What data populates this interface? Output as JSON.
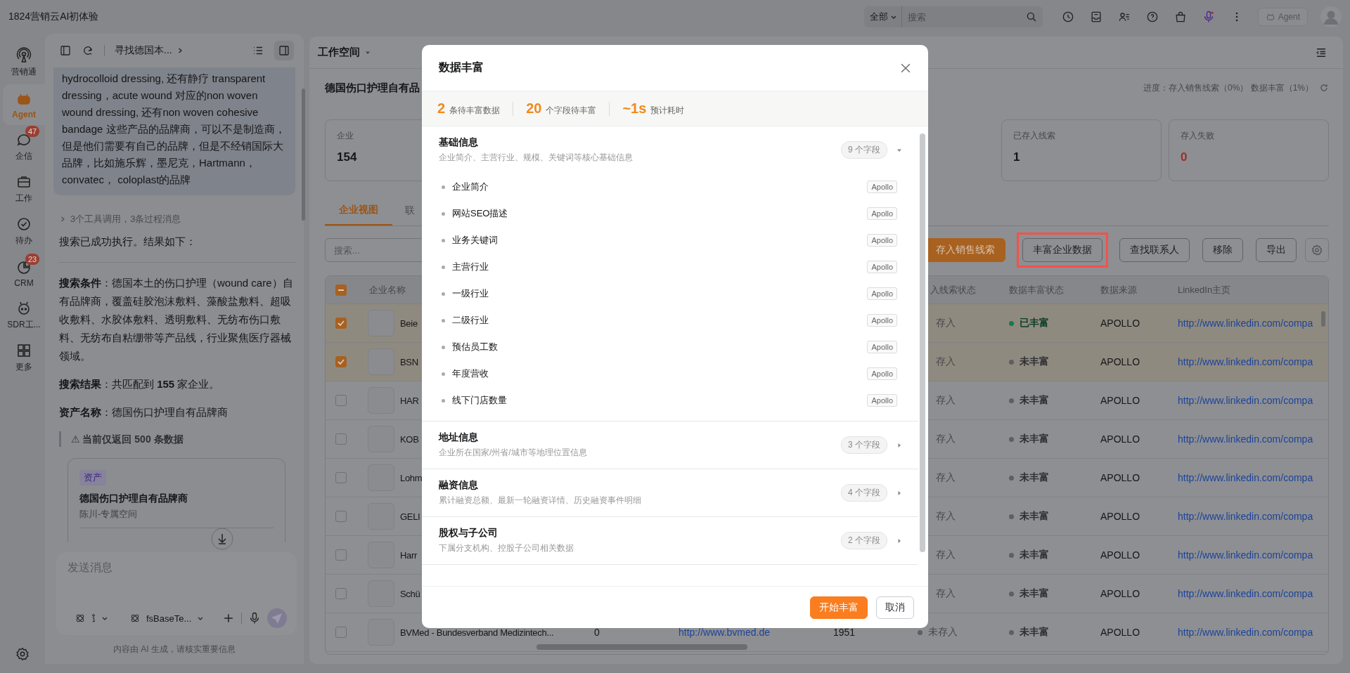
{
  "app_title": "1824营销云AI初体验",
  "top_search": {
    "scope": "全部",
    "placeholder": "搜索"
  },
  "agent_button": {
    "label": "Agent",
    "disabled": true
  },
  "nav_rail": [
    {
      "label": "营销通",
      "selected": false
    },
    {
      "label": "Agent",
      "selected": true
    },
    {
      "label": "企信",
      "selected": false,
      "badge": "47"
    },
    {
      "label": "工作",
      "selected": false
    },
    {
      "label": "待办",
      "selected": false
    },
    {
      "label": "CRM",
      "selected": false,
      "badge": "23"
    },
    {
      "label": "SDR工...",
      "selected": false
    },
    {
      "label": "更多",
      "selected": false
    }
  ],
  "chat": {
    "title": "寻找德国本...",
    "user_message": "hydrocolloid dressing, 还有静疗 transparent dressing，acute wound 对应的non woven wound dressing, 还有non woven cohesive bandage 这些产品的品牌商，可以不是制造商，但是他们需要有自己的品牌，但是不经销国际大品牌，比如施乐辉，墨尼克，Hartmann，convatec， coloplast的品牌",
    "tool_summary": "3个工具调用，3条过程消息",
    "result_intro": "搜索已成功执行。结果如下：",
    "paragraphs": [
      "**搜索条件**：德国本土的伤口护理（wound care）自有品牌商，覆盖硅胶泡沫敷料、藻酸盐敷料、超吸收敷料、水胶体敷料、透明敷料、无纺布伤口敷料、无纺布自粘绷带等产品线，行业聚焦医疗器械领域。",
      "**搜索结果**：共匹配到 **155** 家企业。",
      "**资产名称**：德国伤口护理自有品牌商"
    ],
    "notice": "⚠ 当前仅返回 500 条数据",
    "asset_card": {
      "tag": "资产",
      "title": "德国伤口护理自有品牌商",
      "subtitle": "陈川-专属空间"
    },
    "input": {
      "placeholder": "发送消息",
      "model": "fsBaseTe..."
    },
    "disclaimer": "内容由 AI 生成，请核实重要信息"
  },
  "workspace": {
    "title": "工作空间",
    "asset_title": "德国伤口护理自有品",
    "progress": "进度：存入销售线索（0%） 数据丰富（1%）"
  },
  "stat_cards": [
    {
      "label": "企业",
      "value": "154",
      "kind": "normal"
    },
    {
      "label": "已存入线索",
      "value": "1",
      "kind": "normal"
    },
    {
      "label": "存入失败",
      "value": "0",
      "kind": "error"
    }
  ],
  "tabs": [
    {
      "label": "企业视图",
      "selected": true
    },
    {
      "label": "联",
      "selected": false
    }
  ],
  "list_search": {
    "placeholder": "搜索..."
  },
  "toolbar_buttons": [
    {
      "label": "存入销售线索",
      "kind": "primary",
      "highlighted": false
    },
    {
      "label": "丰富企业数据",
      "kind": "default",
      "highlighted": true
    },
    {
      "label": "查找联系人",
      "kind": "default",
      "highlighted": false
    },
    {
      "label": "移除",
      "kind": "default",
      "highlighted": false
    },
    {
      "label": "导出",
      "kind": "default",
      "highlighted": false
    }
  ],
  "table": {
    "select_all_partial": true,
    "columns": [
      {
        "label": "企业名称"
      },
      {
        "label": "入线索状态"
      },
      {
        "label": "数据丰富状态"
      },
      {
        "label": "数据来源"
      },
      {
        "label": "LinkedIn主页"
      }
    ],
    "rows": [
      {
        "checked": true,
        "name": "Beie",
        "lead": "存入",
        "lead_dot": false,
        "enrich": "已丰富",
        "color": "#157a4a",
        "source": "APOLLO",
        "linkedin": "http://www.linkedin.com/compa"
      },
      {
        "checked": true,
        "name": "BSN",
        "lead": "存入",
        "lead_dot": false,
        "enrich": "未丰富",
        "color": "#5c5f63",
        "source": "APOLLO",
        "linkedin": "http://www.linkedin.com/compa"
      },
      {
        "checked": false,
        "name": "HAR",
        "lead": "存入",
        "lead_dot": false,
        "enrich": "未丰富",
        "color": "#5c5f63",
        "source": "APOLLO",
        "linkedin": "http://www.linkedin.com/compa"
      },
      {
        "checked": false,
        "name": "KOB",
        "lead": "存入",
        "lead_dot": false,
        "enrich": "未丰富",
        "color": "#5c5f63",
        "source": "APOLLO",
        "linkedin": "http://www.linkedin.com/compa"
      },
      {
        "checked": false,
        "name": "Lohm",
        "lead": "存入",
        "lead_dot": false,
        "enrich": "未丰富",
        "color": "#5c5f63",
        "source": "APOLLO",
        "linkedin": "http://www.linkedin.com/compa"
      },
      {
        "checked": false,
        "name": "GELI",
        "lead": "存入",
        "lead_dot": false,
        "enrich": "未丰富",
        "color": "#5c5f63",
        "source": "APOLLO",
        "linkedin": "http://www.linkedin.com/compa"
      },
      {
        "checked": false,
        "name": "Harr",
        "lead": "存入",
        "lead_dot": false,
        "enrich": "未丰富",
        "color": "#5c5f63",
        "source": "APOLLO",
        "linkedin": "http://www.linkedin.com/compa"
      },
      {
        "checked": false,
        "name": "Schü",
        "lead": "存入",
        "lead_dot": false,
        "enrich": "未丰富",
        "color": "#5c5f63",
        "source": "APOLLO",
        "linkedin": "http://www.linkedin.com/compa"
      },
      {
        "checked": false,
        "name": "BVMed - Bundesverband Medizintech...",
        "employees": "0",
        "website": "http://www.bvmed.de",
        "year": "1951",
        "lead": "未存入",
        "lead_dot": true,
        "enrich": "未丰富",
        "color": "#5c5f63",
        "source": "APOLLO",
        "linkedin": "http://www.linkedin.com/compa"
      }
    ]
  },
  "enrich_dialog": {
    "title": "数据丰富",
    "stats": [
      {
        "value": "2",
        "label": "条待丰富数据"
      },
      {
        "value": "20",
        "label": "个字段待丰富"
      },
      {
        "value": "~1s",
        "label": "预计耗时"
      }
    ],
    "sections": [
      {
        "title": "基础信息",
        "description": "企业简介、主营行业、规模、关键词等核心基础信息",
        "count": "9 个字段",
        "expanded": true,
        "fields": [
          {
            "name": "企业简介",
            "source": "Apollo"
          },
          {
            "name": "网站SEO描述",
            "source": "Apollo"
          },
          {
            "name": "业务关键词",
            "source": "Apollo"
          },
          {
            "name": "主营行业",
            "source": "Apollo"
          },
          {
            "name": "一级行业",
            "source": "Apollo"
          },
          {
            "name": "二级行业",
            "source": "Apollo"
          },
          {
            "name": "预估员工数",
            "source": "Apollo"
          },
          {
            "name": "年度营收",
            "source": "Apollo"
          },
          {
            "name": "线下门店数量",
            "source": "Apollo"
          }
        ]
      },
      {
        "title": "地址信息",
        "description": "企业所在国家/州省/城市等地理位置信息",
        "count": "3 个字段",
        "expanded": false
      },
      {
        "title": "融资信息",
        "description": "累计融资总额、最新一轮融资详情、历史融资事件明细",
        "count": "4 个字段",
        "expanded": false
      },
      {
        "title": "股权与子公司",
        "description": "下属分支机构、控股子公司相关数据",
        "count": "2 个字段",
        "expanded": false
      }
    ],
    "buttons": [
      {
        "label": "开始丰富",
        "kind": "primary"
      },
      {
        "label": "取消",
        "kind": "default"
      }
    ]
  }
}
